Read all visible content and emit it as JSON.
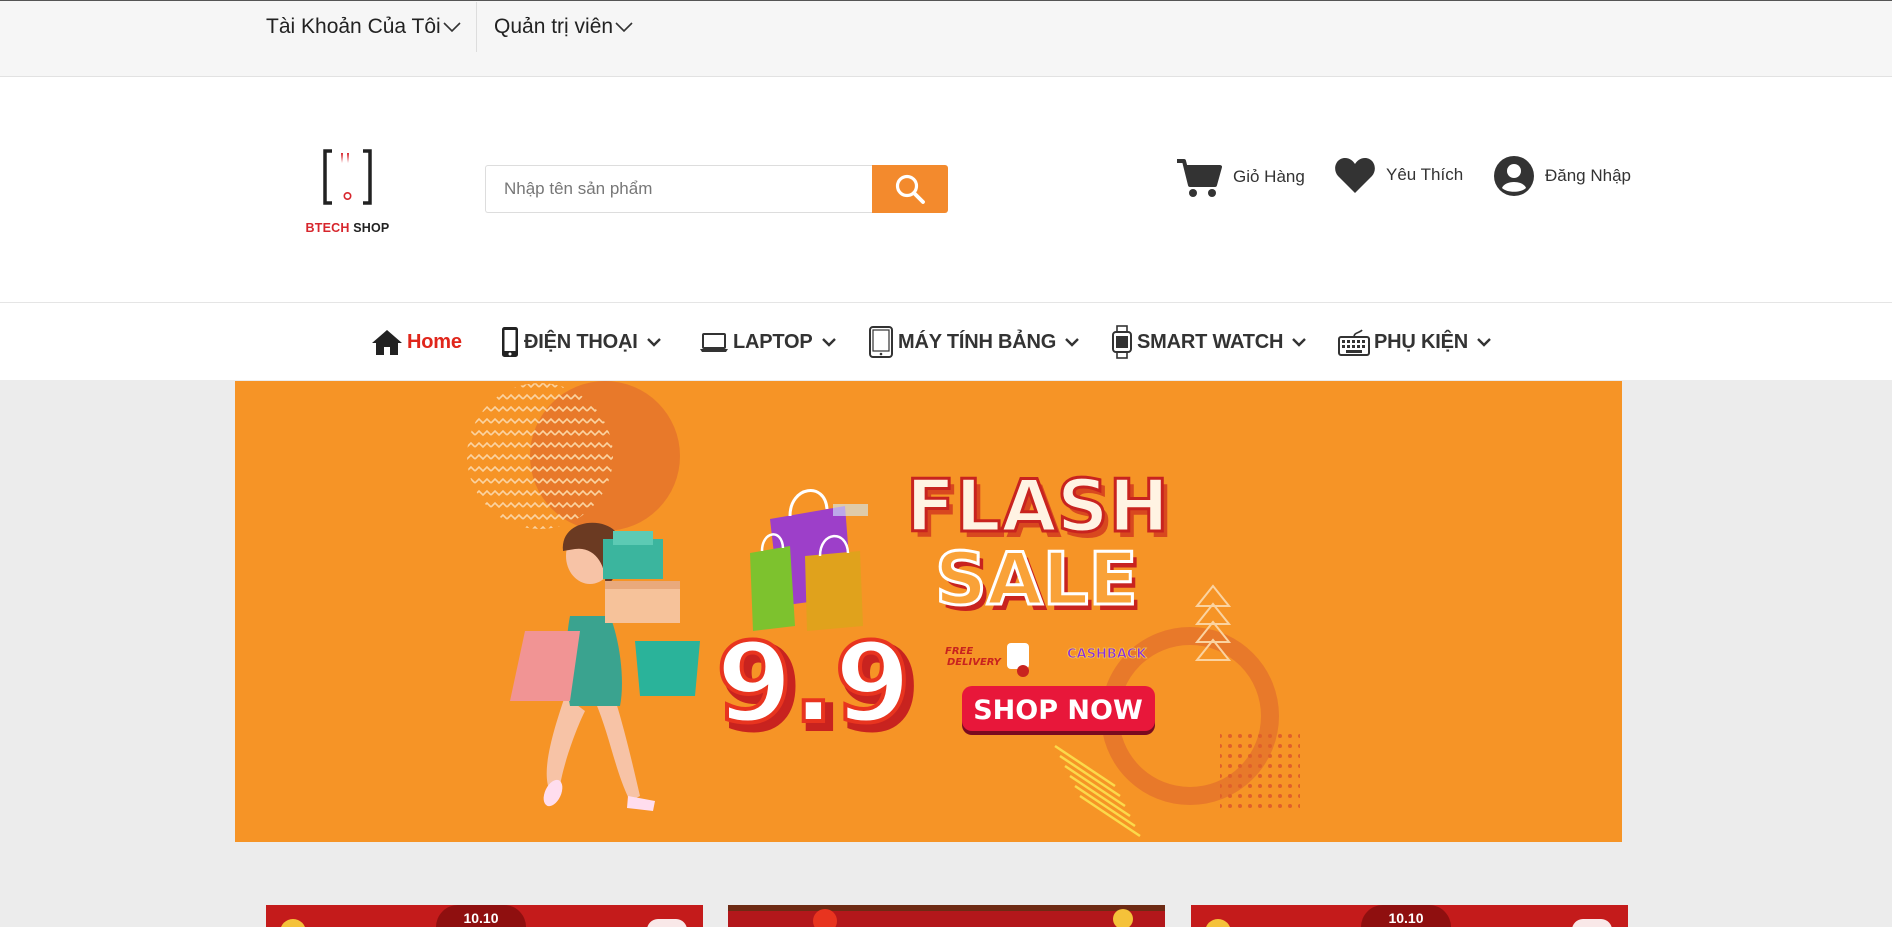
{
  "topbar": {
    "account_label": "Tài Khoản Của Tôi",
    "admin_label": "Quản trị viên"
  },
  "header": {
    "logo_text_red": "BTECH",
    "logo_text_dark": "SHOP",
    "search_placeholder": "Nhập tên sản phẩm",
    "cart_label": "Giỏ Hàng",
    "wishlist_label": "Yêu Thích",
    "login_label": "Đăng Nhập"
  },
  "nav": {
    "items": [
      {
        "label": "Home",
        "icon": "home-icon",
        "active": true
      },
      {
        "label": "ĐIỆN THOẠI",
        "icon": "phone-icon"
      },
      {
        "label": "LAPTOP",
        "icon": "laptop-icon"
      },
      {
        "label": "MÁY TÍNH BẢNG",
        "icon": "tablet-icon"
      },
      {
        "label": "SMART WATCH",
        "icon": "watch-icon"
      },
      {
        "label": "PHỤ KIỆN",
        "icon": "keyboard-icon"
      }
    ]
  },
  "banner": {
    "title_line1": "FLASH",
    "title_line2": "SALE",
    "date": "9.9",
    "free_delivery_line1": "FREE",
    "free_delivery_line2": "DELIVERY",
    "cashback": "CASHBACK",
    "cta": "SHOP NOW"
  },
  "promos": [
    {
      "tag": "10.10"
    },
    {
      "tag": ""
    },
    {
      "tag": "10.10"
    }
  ],
  "colors": {
    "accent": "#f38a2d",
    "banner_bg": "#f69426",
    "active_nav": "#e0261b",
    "cta_bg": "#e8173a"
  }
}
